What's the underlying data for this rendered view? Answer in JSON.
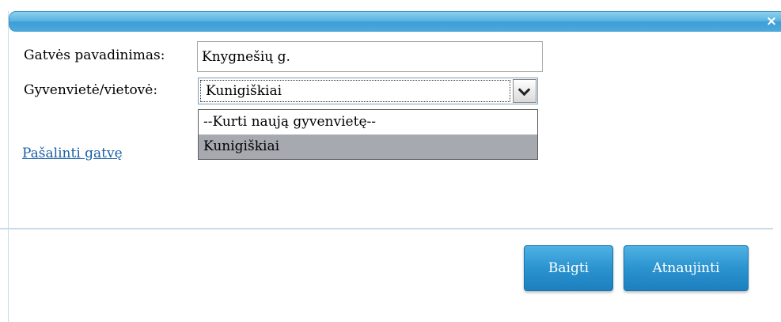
{
  "dialog": {
    "close_symbol": "×"
  },
  "form": {
    "street_label": "Gatvės pavadinimas:",
    "street_value": "Knygnešių g.",
    "town_label": "Gyvenvietė/vietovė:",
    "town_selected": "Kunigiškiai",
    "town_options": [
      "--Kurti naują gyvenvietę--",
      "Kunigiškiai"
    ],
    "remove_link": "Pašalinti gatvę"
  },
  "footer": {
    "finish_label": "Baigti",
    "update_label": "Atnaujinti"
  },
  "icons": {
    "close": "close-icon",
    "dropdown": "chevron-down-icon"
  },
  "colors": {
    "titlebar": "#4aa9dd",
    "button": "#2b93cf",
    "link": "#1a5fa6",
    "selected_option": "#a7a9b0"
  }
}
